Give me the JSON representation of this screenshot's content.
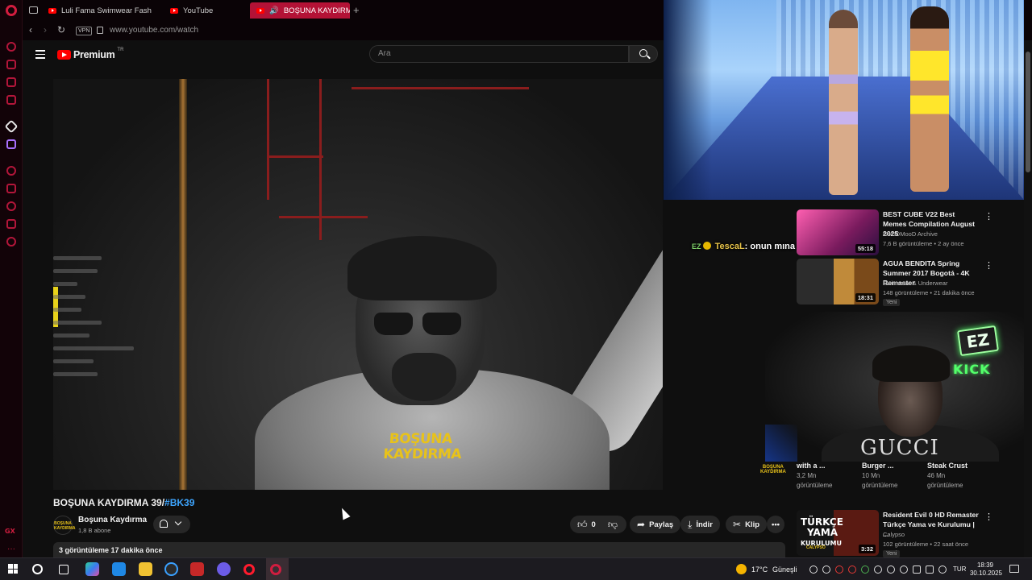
{
  "browser": {
    "tabs": [
      {
        "label": "Luli Fama Swimwear Fash"
      },
      {
        "label": "YouTube"
      },
      {
        "label": "BOŞUNA KAYDIRMA",
        "active": true
      }
    ],
    "url": "www.youtube.com/watch",
    "vpn_label": "VPN"
  },
  "youtube": {
    "logo_text": "Premium",
    "logo_sup": "TR",
    "search_placeholder": "Ara"
  },
  "video": {
    "title_text": "BOŞUNA KAYDIRMA 39/",
    "title_tag": "#BK39",
    "channel_name": "Boşuna Kaydırma",
    "subscribers": "1,8 B abone",
    "like_count": "0",
    "share_label": "Paylaş",
    "download_label": "İndir",
    "clip_label": "Klip",
    "views_date": "3 görüntüleme  17 dakika önce",
    "shirt_line1": "BOŞUNA",
    "shirt_line2": "KAYDIRMA",
    "avatar_text": "BOŞUNA KAYDIRMA"
  },
  "chat_overlay": {
    "ez": "EZ",
    "badge": "!",
    "user": "TescaL",
    "message": ": onun mına koydular işte"
  },
  "recommendations": [
    {
      "title": "BEST CUBE V22 Best Memes Compilation August 2025",
      "channel": "GoODMooD Archive",
      "meta": "7,6 B görüntüleme • 2 ay önce",
      "duration": "55:18"
    },
    {
      "title": "AGUA BENDITA Spring Summer 2017 Bogotá - 4K Remaster",
      "channel": "Swimwear & Underwear",
      "meta": "148 görüntüleme • 21 dakika önce",
      "duration": "18:31",
      "badge": "Yeni"
    },
    {
      "title": "Resident Evil 0 HD Remaster Türkçe Yama ve Kurulumu | ...",
      "channel": "Calypso",
      "meta": "102 görüntüleme • 22 saat önce",
      "duration": "3:32",
      "badge": "Yeni",
      "thumb_text_1": "TÜRKÇE",
      "thumb_text_2": "YAMA",
      "thumb_text_3": "KURULUMU",
      "thumb_sub": "CALYPSO"
    }
  ],
  "grid_items": [
    {
      "title": "with a ...",
      "views": "3,2 Mn",
      "views_label": "görüntüleme"
    },
    {
      "title": "Burger ...",
      "views": "10 Mn",
      "views_label": "görüntüleme"
    },
    {
      "title": "Steak Crust",
      "views": "46 Mn",
      "views_label": "görüntüleme"
    }
  ],
  "webcam": {
    "ez_text": "EZ",
    "kick_text": "KICK",
    "brand_text": "GUCCI"
  },
  "taskbar": {
    "temperature": "17°C",
    "weather": "Güneşli",
    "language": "TUR",
    "time": "18:39",
    "date": "30.10.2025"
  },
  "sidebar": {
    "gx_label": "GX",
    "more": "···"
  }
}
